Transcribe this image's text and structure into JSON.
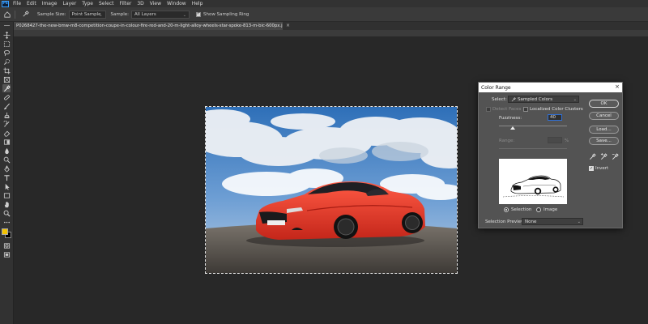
{
  "app": {
    "logo": "Ps"
  },
  "menu": [
    "File",
    "Edit",
    "Image",
    "Layer",
    "Type",
    "Select",
    "Filter",
    "3D",
    "View",
    "Window",
    "Help"
  ],
  "options_bar": {
    "sample_size_label": "Sample Size:",
    "sample_size_value": "Point Sample",
    "sample_label": "Sample:",
    "sample_value": "All Layers",
    "show_sampling_ring": "Show Sampling Ring",
    "show_sampling_ring_checked": true
  },
  "document": {
    "tab_title": "P0268427-the-new-bmw-m8-competition-coupe-in-colour-fire-red-and-20-m-light-alloy-wheels-star-spoke-813-m-bic-600px.jpg @ 124% (RGB/8#)",
    "close_glyph": "×"
  },
  "toolbar": {
    "icons": [
      "move-icon",
      "marquee-icon",
      "lasso-icon",
      "quick-select-icon",
      "crop-icon",
      "frame-icon",
      "eyedropper-icon",
      "healing-icon",
      "brush-icon",
      "clone-stamp-icon",
      "history-brush-icon",
      "eraser-icon",
      "gradient-icon",
      "blur-icon",
      "dodge-icon",
      "pen-icon",
      "type-icon",
      "path-select-icon",
      "rectangle-icon",
      "hand-icon",
      "zoom-icon",
      "more-tools-icon"
    ],
    "active_tool": "eyedropper-icon",
    "foreground_color": "#f2c200",
    "background_color": "#000000"
  },
  "color_range": {
    "title": "Color Range",
    "close_glyph": "×",
    "select_label": "Select:",
    "select_value": "Sampled Colors",
    "detect_faces": "Detect Faces",
    "localized_clusters": "Localized Color Clusters",
    "fuzziness_label": "Fuzziness:",
    "fuzziness_value": "40",
    "fuzziness_fraction": 0.2,
    "range_label": "Range:",
    "range_unit": "%",
    "selection_label": "Selection",
    "image_label": "Image",
    "preview_label": "Selection Preview:",
    "preview_value": "None",
    "ok": "OK",
    "cancel": "Cancel",
    "load": "Load...",
    "save": "Save...",
    "invert": "Invert",
    "invert_checked": true
  },
  "colors": {
    "car": "#e8382a",
    "sky_top": "#2e6fb8",
    "ground": "#5a5550"
  }
}
